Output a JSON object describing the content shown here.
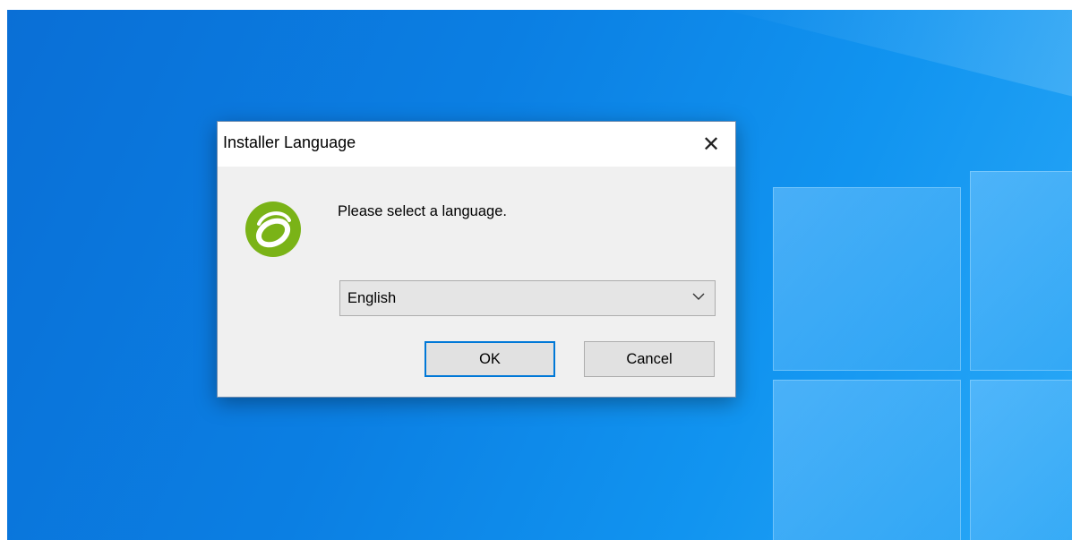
{
  "dialog": {
    "title": "Installer Language",
    "close_label": "✕",
    "prompt": "Please select a language.",
    "language_select": {
      "selected": "English"
    },
    "ok_label": "OK",
    "cancel_label": "Cancel"
  },
  "icons": {
    "app_logo": "green-circle-logo-icon",
    "dropdown": "chevron-down-icon",
    "close": "close-icon"
  },
  "colors": {
    "accent": "#0078d7",
    "logo_green": "#7ab317",
    "desktop_blue": "#0b7fe3"
  }
}
